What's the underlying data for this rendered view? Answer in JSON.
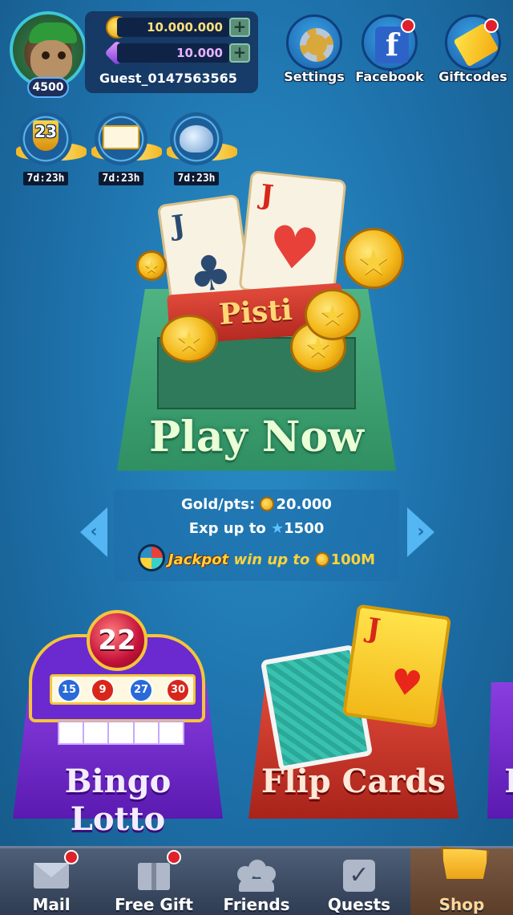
{
  "player": {
    "level": "4500",
    "username": "Guest_0147563565",
    "gold": "10.000.000",
    "gems": "10.000"
  },
  "top_buttons": {
    "settings": "Settings",
    "facebook": "Facebook",
    "facebook_letter": "f",
    "giftcodes": "Giftcodes"
  },
  "events": [
    {
      "icon": "trophy-icon",
      "badge_number": "23",
      "timer": "7d:23h"
    },
    {
      "icon": "lotto-board-icon",
      "timer": "7d:23h"
    },
    {
      "icon": "shark-icon",
      "timer": "7d:23h"
    }
  ],
  "main_game": {
    "title": "Pisti",
    "card_letter": "J",
    "play_label": "Play Now",
    "gold_label": "Gold/pts:",
    "gold_value": "20.000",
    "exp_label": "Exp up to",
    "exp_value": "1500",
    "jackpot_label": "Jackpot",
    "jackpot_text": "win up to",
    "jackpot_value": "100M"
  },
  "games": {
    "bingo": {
      "title": "Bingo Lotto",
      "big_ball": "22",
      "balls": [
        "15",
        "9",
        "27",
        "30"
      ]
    },
    "flip": {
      "title": "Flip Cards",
      "card_letter": "J"
    },
    "extra": {
      "title": "B"
    }
  },
  "bottom_nav": {
    "mail": "Mail",
    "free_gift": "Free Gift",
    "friends": "Friends",
    "quests": "Quests",
    "shop": "Shop"
  },
  "colors": {
    "background": "#1d6fa8",
    "play_table": "#3fa372",
    "bingo_tile": "#7a2ed6",
    "flip_tile": "#c8332a",
    "notification": "#e0202a"
  }
}
